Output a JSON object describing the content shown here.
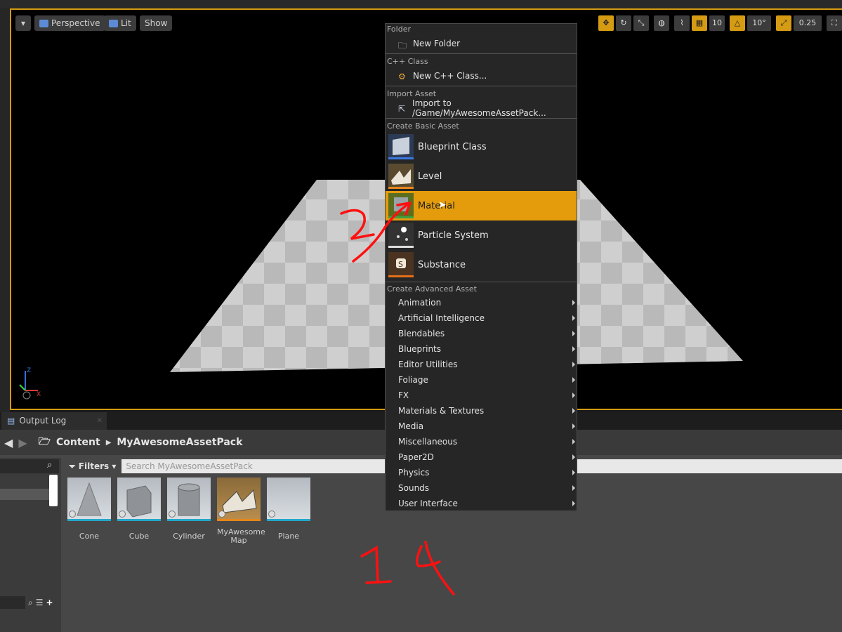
{
  "viewport": {
    "options_menu": "▾",
    "perspective": "Perspective",
    "lit": "Lit",
    "show": "Show",
    "snap_grid": "10",
    "snap_rotation": "10°",
    "snap_scale": "0.25",
    "axis_z": "Z",
    "axis_x": "X"
  },
  "output_log": {
    "tab_label": "Output Log"
  },
  "content_browser": {
    "path": [
      "Content",
      "MyAwesomeAssetPack"
    ],
    "filters_label": "Filters",
    "search_placeholder": "Search MyAwesomeAssetPack",
    "assets": [
      {
        "label": "Cone"
      },
      {
        "label": "Cube"
      },
      {
        "label": "Cylinder"
      },
      {
        "label": "MyAwesome\nMap"
      },
      {
        "label": "Plane"
      }
    ]
  },
  "context_menu": {
    "folder_header": "Folder",
    "new_folder": "New Folder",
    "cpp_header": "C++ Class",
    "new_cpp_class": "New C++ Class...",
    "import_header": "Import Asset",
    "import_to": "Import to /Game/MyAwesomeAssetPack...",
    "basic_header": "Create Basic Asset",
    "basic_items": [
      "Blueprint Class",
      "Level",
      "Material",
      "Particle System",
      "Substance"
    ],
    "highlighted": "Material",
    "advanced_header": "Create Advanced Asset",
    "advanced_items": [
      "Animation",
      "Artificial Intelligence",
      "Blendables",
      "Blueprints",
      "Editor Utilities",
      "Foliage",
      "FX",
      "Materials & Textures",
      "Media",
      "Miscellaneous",
      "Paper2D",
      "Physics",
      "Sounds",
      "User Interface"
    ]
  },
  "annotations": {
    "marks": [
      "2",
      "1",
      "4"
    ],
    "color": "#ff1010"
  },
  "colors": {
    "accent": "#e49c0c",
    "viewport_border": "#d59b12"
  }
}
